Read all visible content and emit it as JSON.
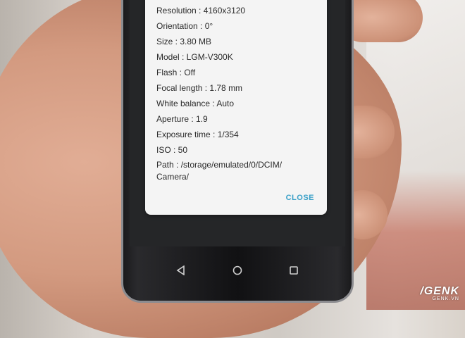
{
  "dialog": {
    "details": [
      "Resolution : 4160x3120",
      "Orientation : 0°",
      "Size : 3.80 MB",
      "Model : LGM-V300K",
      "Flash : Off",
      "Focal length : 1.78 mm",
      "White balance : Auto",
      "Aperture : 1.9",
      "Exposure time : 1/354",
      "ISO : 50",
      "Path : /storage/emulated/0/DCIM/ Camera/"
    ],
    "close_label": "CLOSE"
  },
  "nav": {
    "icons": [
      "back-triangle-icon",
      "home-circle-icon",
      "recents-square-icon"
    ]
  },
  "watermark": {
    "logo": "/GENK",
    "url": "GENK.VN"
  },
  "colors": {
    "dialog_bg": "#f4f4f4",
    "accent": "#3aa0c8",
    "text": "#2b2b2b"
  }
}
